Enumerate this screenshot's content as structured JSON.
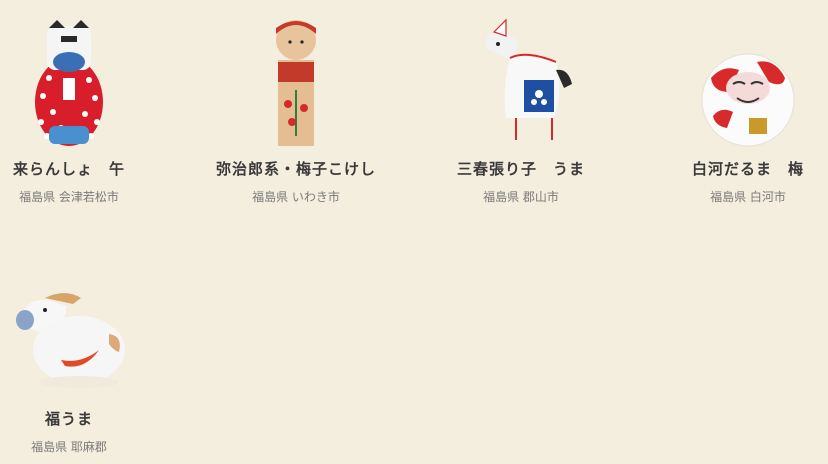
{
  "items": [
    {
      "title": "来らんしょ　午",
      "location": "福島県 会津若松市",
      "icon": "raransho-horse-figure-icon"
    },
    {
      "title": "弥治郎系・梅子こけし",
      "location": "福島県 いわき市",
      "icon": "kokeshi-doll-icon"
    },
    {
      "title": "三春張り子　うま",
      "location": "福島県 郡山市",
      "icon": "miharu-horse-icon"
    },
    {
      "title": "白河だるま　梅",
      "location": "福島県 白河市",
      "icon": "daruma-icon"
    },
    {
      "title": "福うま",
      "location": "福島県 耶麻郡",
      "icon": "fuku-horse-icon"
    }
  ],
  "colors": {
    "background": "#f4eedf",
    "title": "#3a3a3a",
    "location": "#7a7a7a"
  }
}
